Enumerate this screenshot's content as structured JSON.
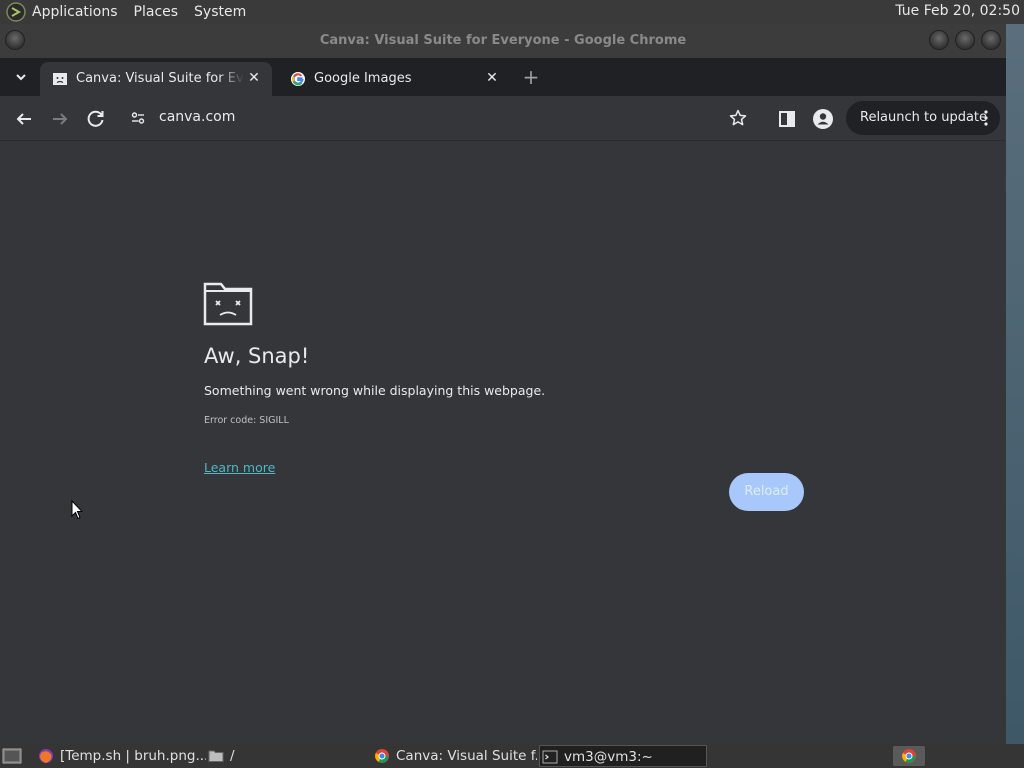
{
  "desktop": {
    "menus": [
      "Applications",
      "Places",
      "System"
    ],
    "clock": "Tue Feb 20, 02:50"
  },
  "window": {
    "title": "Canva: Visual Suite for Everyone - Google Chrome"
  },
  "tabs": [
    {
      "title": "Canva: Visual Suite for Everyone",
      "favicon": "sad-page-icon",
      "active": true
    },
    {
      "title": "Google Images",
      "favicon": "google-icon",
      "active": false
    }
  ],
  "toolbar": {
    "url": "canva.com",
    "relaunch_label": "Relaunch to update"
  },
  "error": {
    "title": "Aw, Snap!",
    "message": "Something went wrong while displaying this webpage.",
    "code": "Error code: SIGILL",
    "learn_more": "Learn more",
    "reload": "Reload"
  },
  "taskbar": {
    "items": [
      {
        "label": "[Temp.sh | bruh.png...",
        "icon": "firefox-icon"
      },
      {
        "label": "/",
        "icon": "folder-icon"
      },
      {
        "label": "Canva: Visual Suite f...",
        "icon": "chrome-icon"
      },
      {
        "label": "vm3@vm3:~",
        "icon": "terminal-icon"
      }
    ]
  },
  "colors": {
    "page_bg": "#35363a",
    "tabstrip_bg": "#202124",
    "link": "#4fb6c6",
    "reload_button": "#a8c7fa"
  }
}
